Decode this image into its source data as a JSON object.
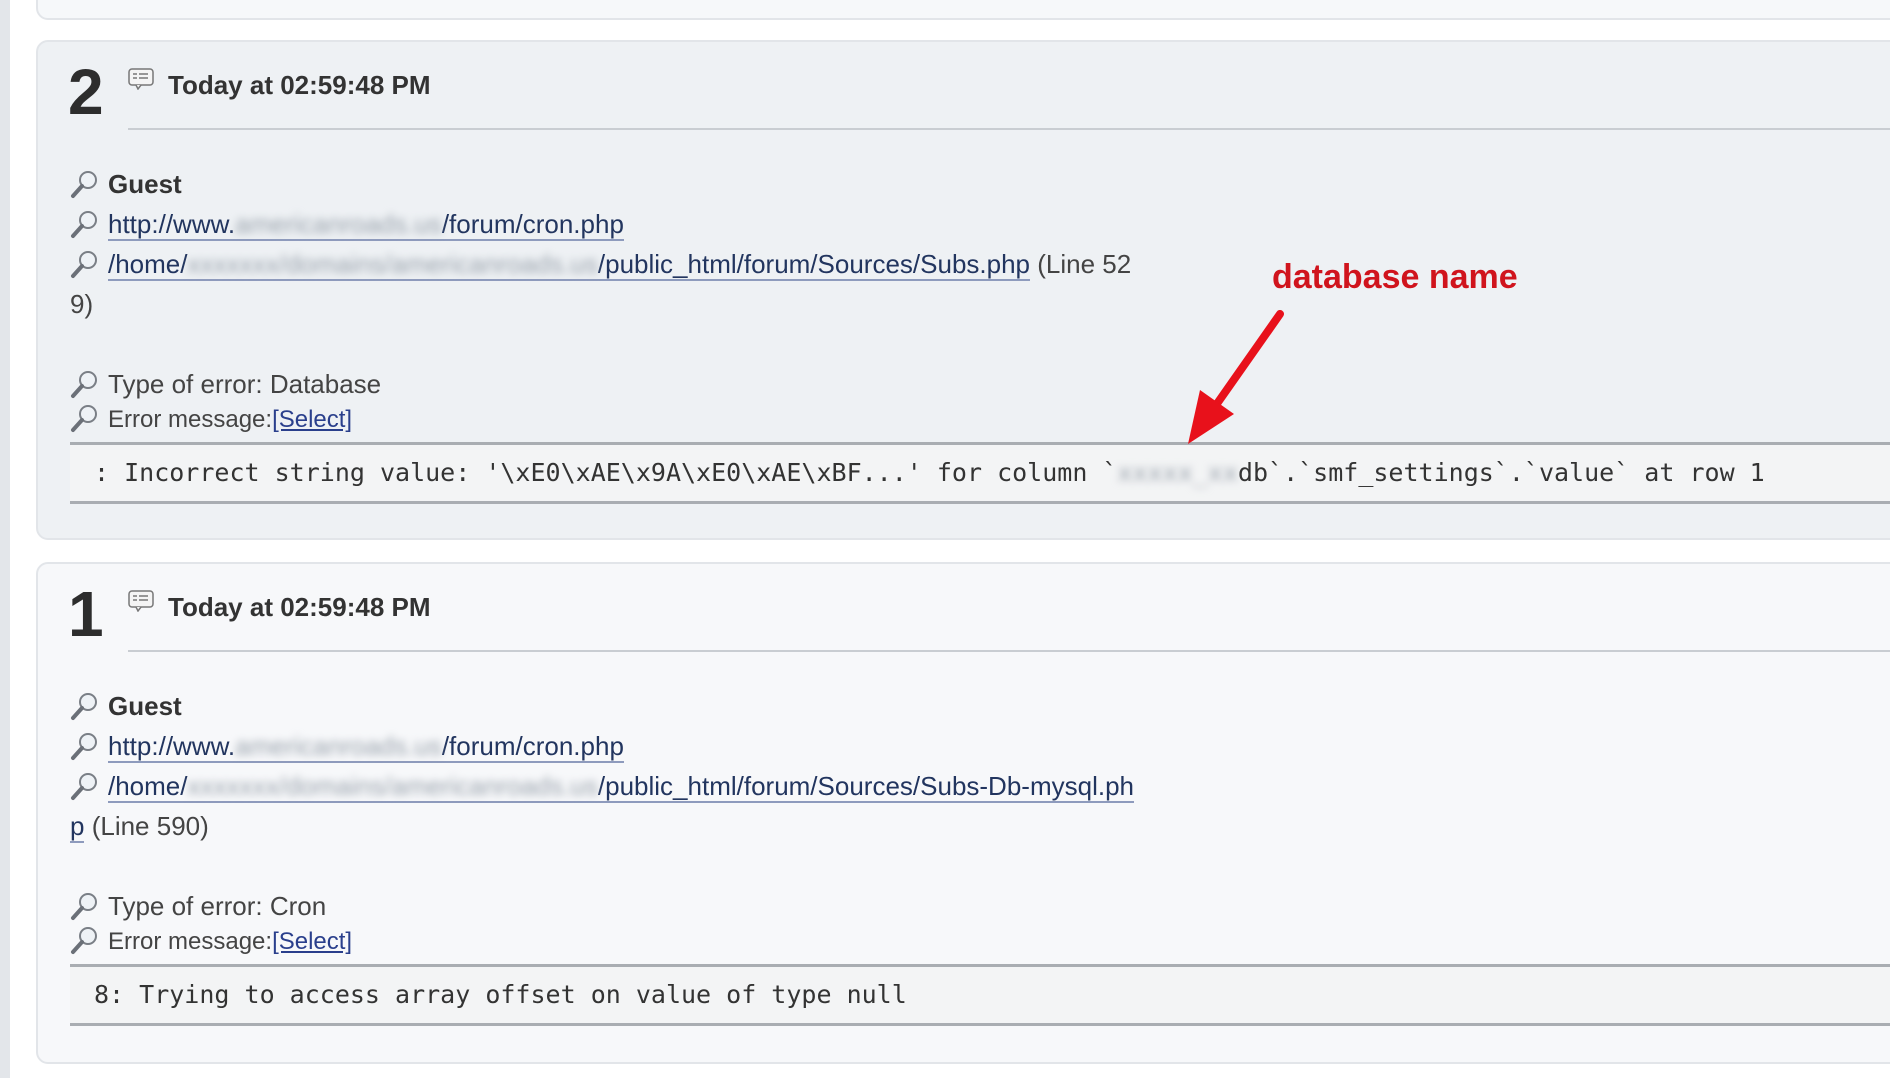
{
  "entries": [
    {
      "number": "2",
      "timestamp": "Today at 02:59:48 PM",
      "member": "Guest",
      "url_prefix": "http://www.",
      "url_hidden": "americanroads.us",
      "url_suffix": "/forum/cron.php",
      "file_prefix": "/home/",
      "file_hidden": "xxxxxxx/domains/americanroads.us",
      "file_suffix": "/public_html/forum/Sources/Subs.php",
      "line_text": "(Line 52",
      "line_wrap": "9)",
      "type_of_error": "Type of error: Database",
      "error_message_label": "Error message:",
      "select_label": "[Select]",
      "error_text_prefix": ": Incorrect string value: '\\xE0\\xAE\\x9A\\xE0\\xAE\\xBF...' for column `",
      "error_text_hidden": "xxxxx_xx",
      "error_text_suffix": "db`.`smf_settings`.`value` at row 1"
    },
    {
      "number": "1",
      "timestamp": "Today at 02:59:48 PM",
      "member": "Guest",
      "url_prefix": "http://www.",
      "url_hidden": "americanroads.us",
      "url_suffix": "/forum/cron.php",
      "file_prefix": "/home/",
      "file_hidden": "xxxxxxx/domains/americanroads.us",
      "file_suffix": "/public_html/forum/Sources/Subs-Db-mysql.ph",
      "file_wrap": "p",
      "line_text": "(Line 590)",
      "type_of_error": "Type of error: Cron",
      "error_message_label": "Error message:",
      "select_label": "[Select]",
      "error_text": "8: Trying to access array offset on value of type null"
    }
  ],
  "annotation": {
    "label": "database name",
    "color": "#d0141d"
  },
  "icons": {
    "entry_header": "comment-list-icon",
    "row": "magnifier-icon"
  }
}
